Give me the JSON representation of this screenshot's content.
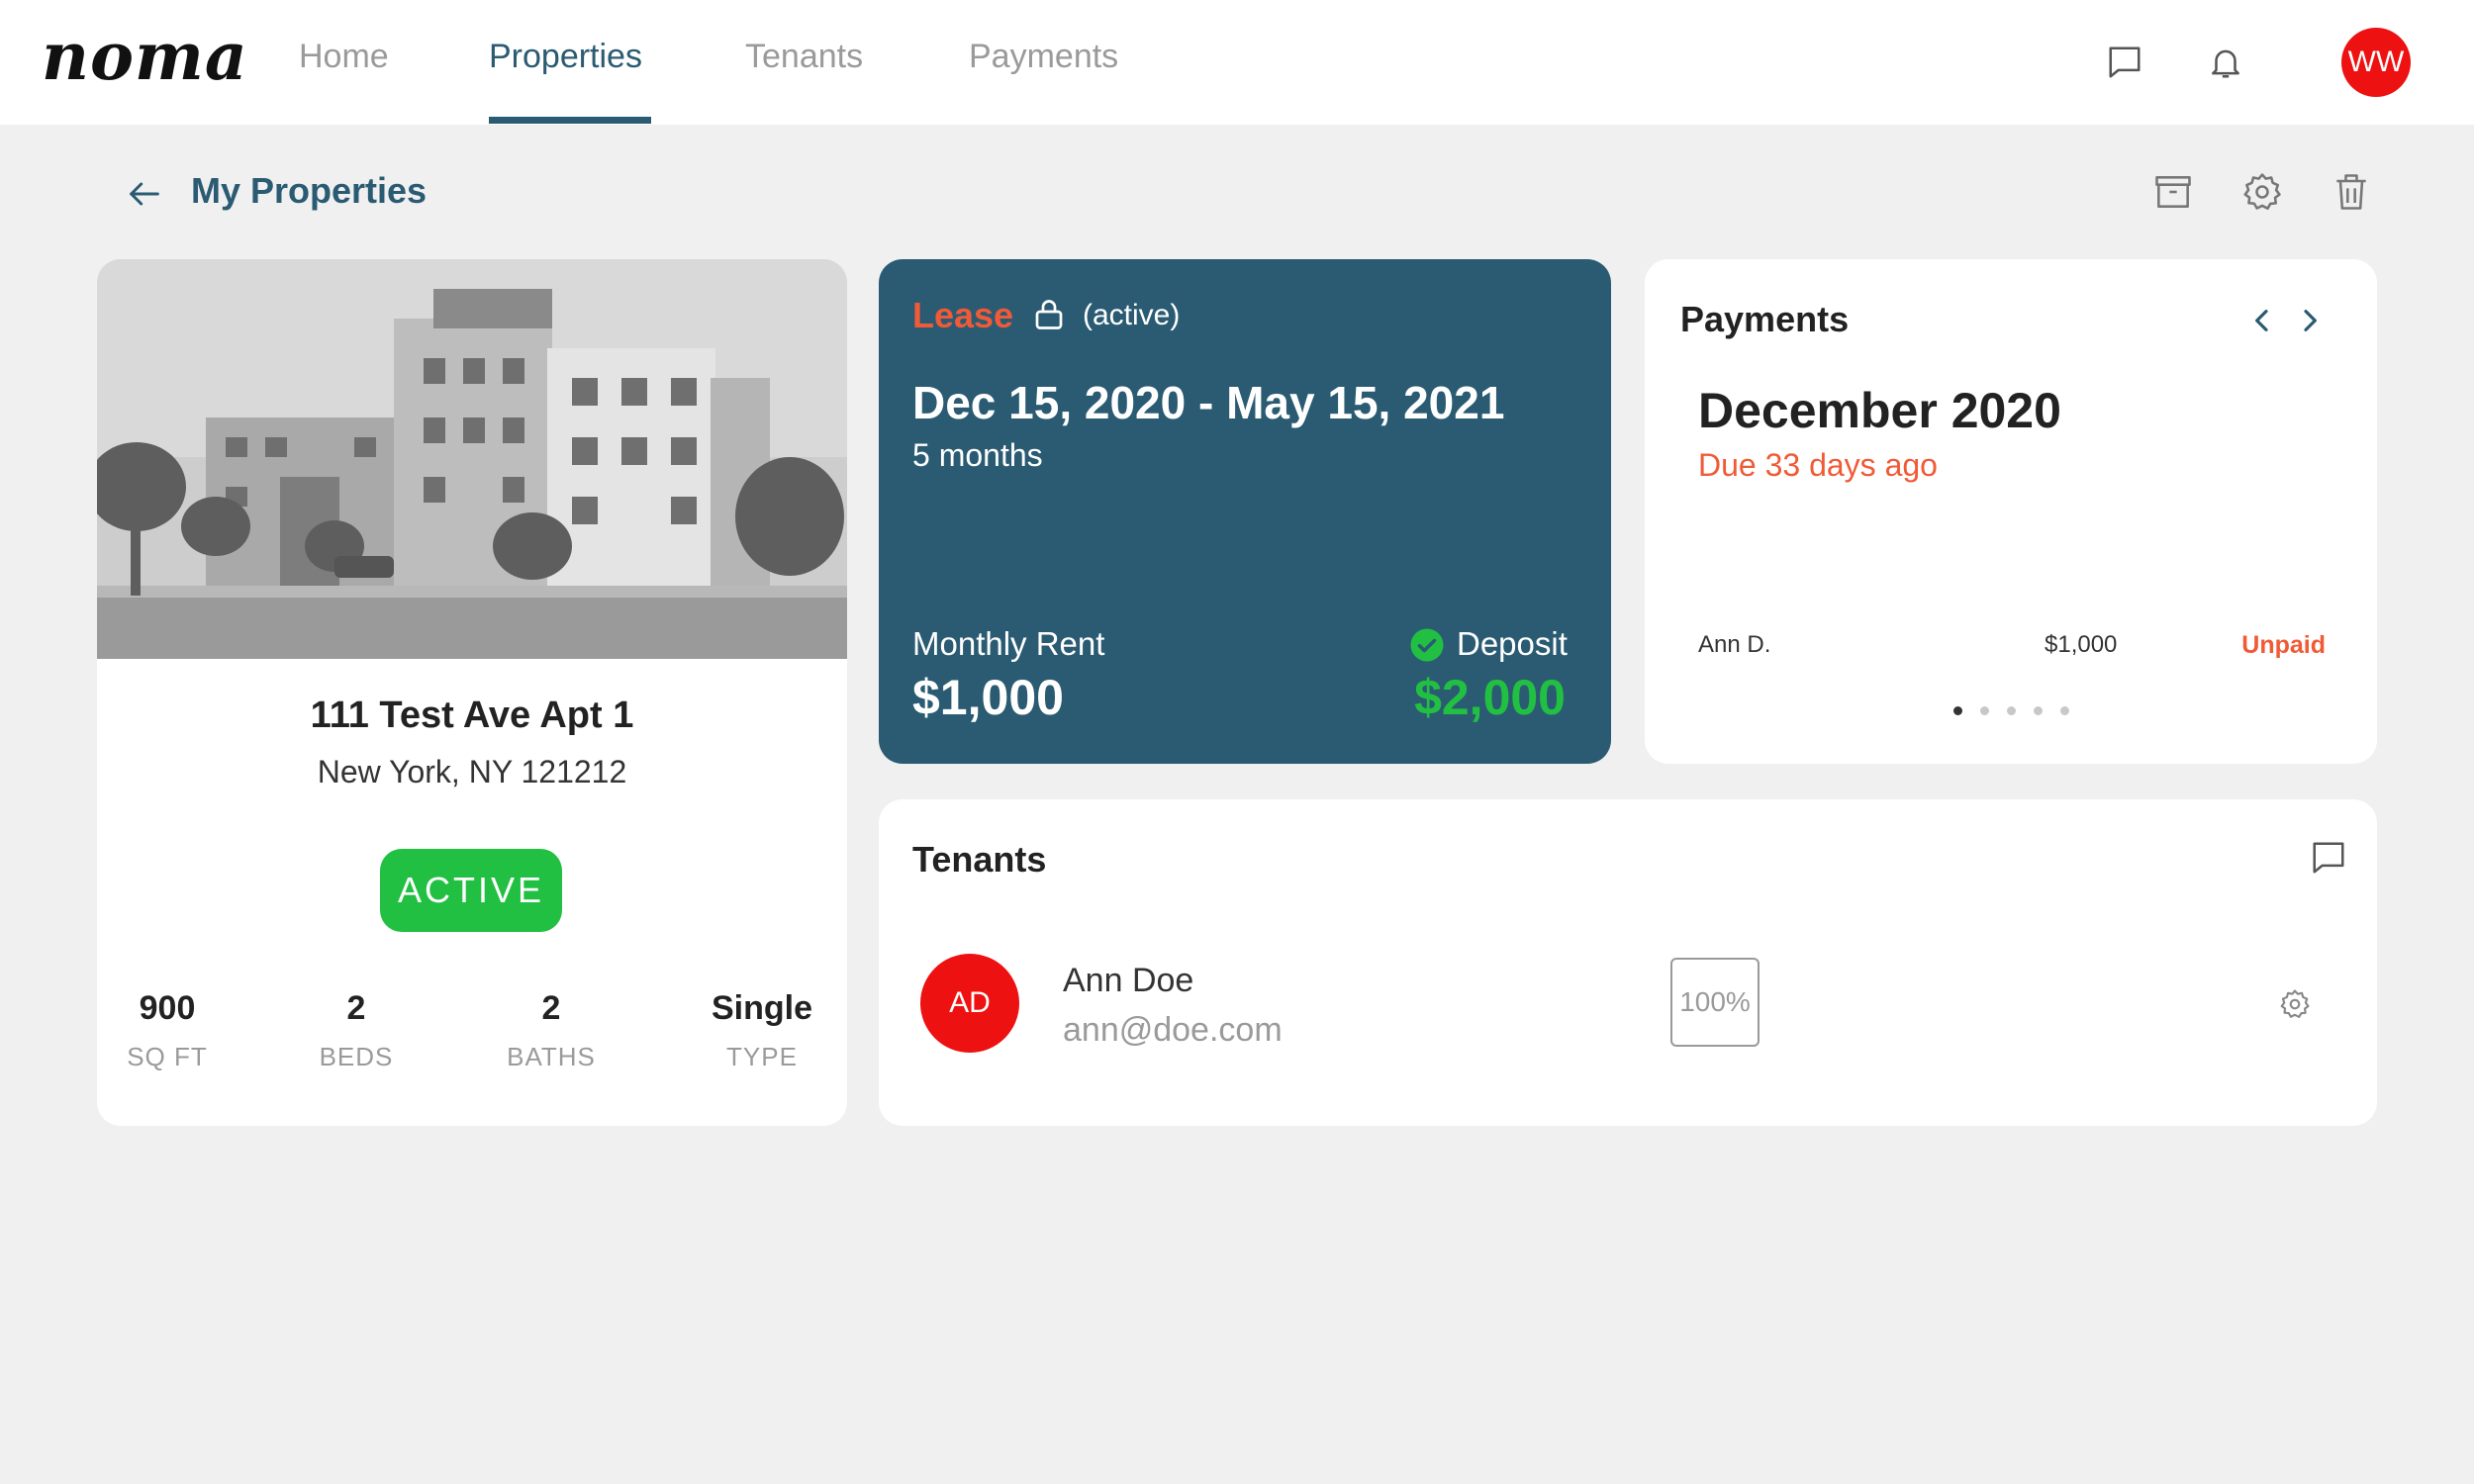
{
  "app": {
    "logo": "noma"
  },
  "nav": {
    "tabs": [
      {
        "label": "Home",
        "active": false
      },
      {
        "label": "Properties",
        "active": true
      },
      {
        "label": "Tenants",
        "active": false
      },
      {
        "label": "Payments",
        "active": false
      }
    ],
    "icons": [
      "chat-icon",
      "bell-icon"
    ],
    "user_initials": "WW",
    "avatar_color": "#ee1111"
  },
  "page": {
    "title": "My Properties",
    "actions": [
      "archive-icon",
      "gear-icon",
      "trash-icon"
    ]
  },
  "property": {
    "address": "111 Test Ave Apt 1",
    "city": "New York, NY 121212",
    "status": "ACTIVE",
    "stats": [
      {
        "value": "900",
        "label": "SQ FT"
      },
      {
        "value": "2",
        "label": "BEDS"
      },
      {
        "value": "2",
        "label": "BATHS"
      },
      {
        "value": "Single",
        "label": "TYPE"
      }
    ]
  },
  "lease": {
    "label": "Lease",
    "status": "(active)",
    "dates": "Dec 15, 2020 - May 15, 2021",
    "duration": "5 months",
    "rent_label": "Monthly Rent",
    "rent_value": "$1,000",
    "deposit_label": "Deposit",
    "deposit_value": "$2,000"
  },
  "payments": {
    "title": "Payments",
    "month": "December 2020",
    "due": "Due 33 days ago",
    "rows": [
      {
        "name": "Ann D.",
        "amount": "$1,000",
        "status": "Unpaid"
      }
    ],
    "page_count": 5,
    "current_page": 1
  },
  "tenants": {
    "title": "Tenants",
    "list": [
      {
        "initials": "AD",
        "name": "Ann Doe",
        "email": "ann@doe.com",
        "share": "100%"
      }
    ]
  },
  "colors": {
    "brand": "#2a5b72",
    "accent_red": "#f05a36",
    "success": "#22c042",
    "avatar": "#ee1111"
  }
}
